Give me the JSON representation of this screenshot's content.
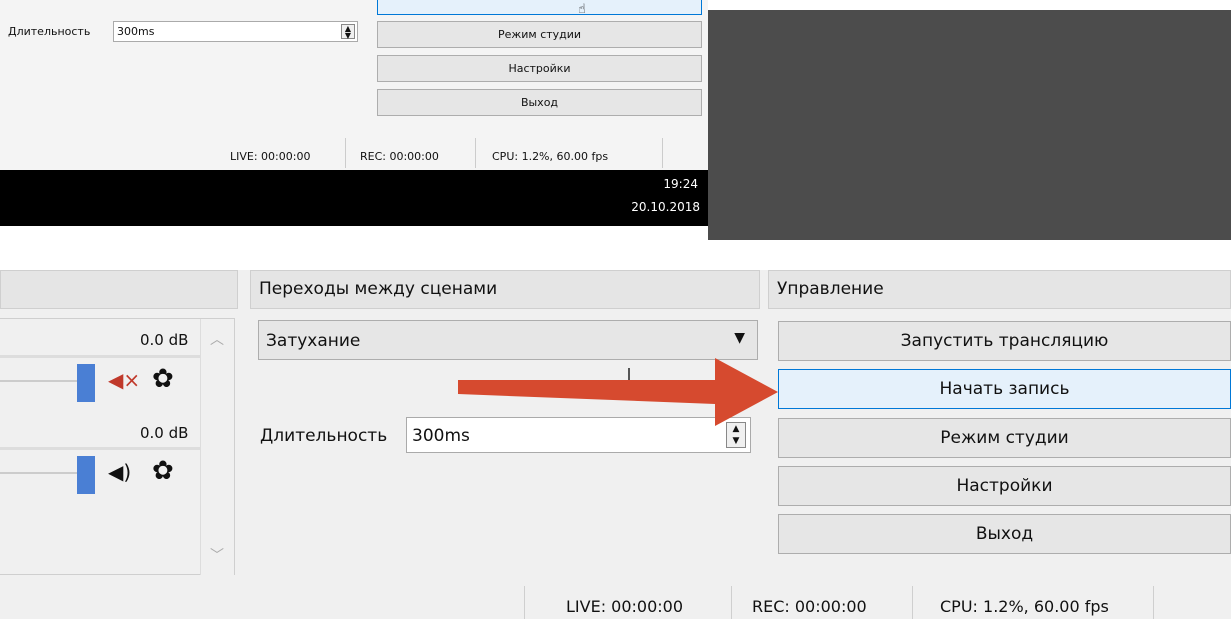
{
  "inner": {
    "duration_label": "Длительность",
    "duration_value": "300ms",
    "buttons": [
      "Режим студии",
      "Настройки",
      "Выход"
    ],
    "status": {
      "live": "LIVE: 00:00:00",
      "rec": "REC: 00:00:00",
      "cpu": "CPU: 1.2%, 60.00 fps"
    }
  },
  "taskbar": {
    "time": "19:24",
    "date": "20.10.2018"
  },
  "mixer": {
    "channels": [
      {
        "level": "0.0 dB",
        "muted": true
      },
      {
        "level": "0.0 dB",
        "muted": false
      }
    ]
  },
  "transitions": {
    "header": "Переходы между сценами",
    "selected": "Затухание",
    "duration_label": "Длительность",
    "duration_value": "300ms"
  },
  "controls": {
    "header": "Управление",
    "buttons": [
      "Запустить трансляцию",
      "Начать запись",
      "Режим студии",
      "Настройки",
      "Выход"
    ]
  },
  "status": {
    "live": "LIVE: 00:00:00",
    "rec": "REC: 00:00:00",
    "cpu": "CPU: 1.2%, 60.00 fps"
  },
  "colors": {
    "accent": "#0078d7",
    "arrow": "#d64a2f",
    "slider": "#4a7fd4",
    "muted_icon": "#c0392b"
  },
  "icons": [
    "mute-icon",
    "speaker-icon",
    "gear-icon",
    "chevron-up-icon",
    "chevron-down-icon",
    "dropdown-arrow-icon",
    "spin-arrows-icon",
    "cursor-icon"
  ]
}
